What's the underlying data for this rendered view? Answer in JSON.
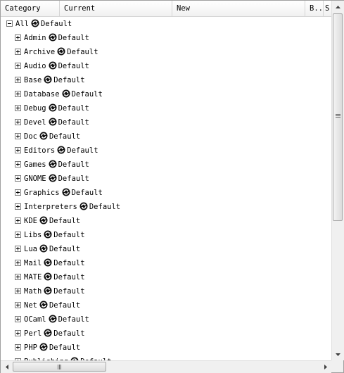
{
  "columns": {
    "category": "Category",
    "current": "Current",
    "new": "New",
    "b": "B..",
    "s": "S"
  },
  "root": {
    "label": "All",
    "value": "Default",
    "expander": "minus"
  },
  "items": [
    {
      "label": "Admin",
      "value": "Default"
    },
    {
      "label": "Archive",
      "value": "Default"
    },
    {
      "label": "Audio",
      "value": "Default"
    },
    {
      "label": "Base",
      "value": "Default"
    },
    {
      "label": "Database",
      "value": "Default"
    },
    {
      "label": "Debug",
      "value": "Default"
    },
    {
      "label": "Devel",
      "value": "Default"
    },
    {
      "label": "Doc",
      "value": "Default"
    },
    {
      "label": "Editors",
      "value": "Default"
    },
    {
      "label": "Games",
      "value": "Default"
    },
    {
      "label": "GNOME",
      "value": "Default"
    },
    {
      "label": "Graphics",
      "value": "Default"
    },
    {
      "label": "Interpreters",
      "value": "Default"
    },
    {
      "label": "KDE",
      "value": "Default"
    },
    {
      "label": "Libs",
      "value": "Default"
    },
    {
      "label": "Lua",
      "value": "Default"
    },
    {
      "label": "Mail",
      "value": "Default"
    },
    {
      "label": "MATE",
      "value": "Default"
    },
    {
      "label": "Math",
      "value": "Default"
    },
    {
      "label": "Net",
      "value": "Default"
    },
    {
      "label": "OCaml",
      "value": "Default"
    },
    {
      "label": "Perl",
      "value": "Default"
    },
    {
      "label": "PHP",
      "value": "Default"
    },
    {
      "label": "Publishing",
      "value": "Default"
    }
  ],
  "icons": {
    "expander_collapsed": "plus-box-icon",
    "expander_expanded": "minus-box-icon",
    "action": "refresh-icon"
  }
}
